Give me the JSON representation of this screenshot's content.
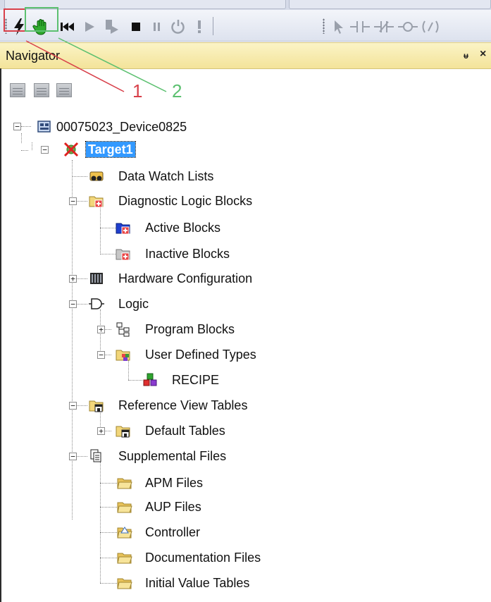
{
  "toolbar": {
    "buttons": [
      {
        "name": "go-online-toggle",
        "icon": "lightning-icon"
      },
      {
        "name": "programmer-mode",
        "icon": "hand-icon"
      },
      {
        "name": "restart",
        "icon": "skip-back-icon"
      },
      {
        "name": "run",
        "icon": "play-icon"
      },
      {
        "name": "run-outputs-disabled",
        "icon": "run-disabled-icon"
      },
      {
        "name": "stop",
        "icon": "stop-icon"
      },
      {
        "name": "pause",
        "icon": "pause-icon"
      },
      {
        "name": "reset",
        "icon": "reset-icon"
      },
      {
        "name": "fault",
        "icon": "exclamation-icon"
      },
      {
        "name": "select",
        "icon": "pointer-icon"
      },
      {
        "name": "no-contact",
        "icon": "contact-no-icon"
      },
      {
        "name": "nc-contact",
        "icon": "contact-nc-icon"
      },
      {
        "name": "coil",
        "icon": "coil-icon"
      },
      {
        "name": "function",
        "icon": "function-icon"
      }
    ]
  },
  "callouts": {
    "one": "1",
    "two": "2"
  },
  "navigator": {
    "title": "Navigator",
    "pin_glyph": "ᵾ",
    "close_glyph": "×"
  },
  "tree": {
    "device": "00075023_Device0825",
    "target": "Target1",
    "items": {
      "data_watch_lists": "Data Watch Lists",
      "diagnostic_logic_blocks": "Diagnostic Logic Blocks",
      "active_blocks": "Active Blocks",
      "inactive_blocks": "Inactive Blocks",
      "hardware_configuration": "Hardware Configuration",
      "logic": "Logic",
      "program_blocks": "Program Blocks",
      "user_defined_types": "User Defined Types",
      "recipe": "RECIPE",
      "reference_view_tables": "Reference View Tables",
      "default_tables": "Default Tables",
      "supplemental_files": "Supplemental Files",
      "apm_files": "APM Files",
      "aup_files": "AUP Files",
      "controller": "Controller",
      "documentation_files": "Documentation Files",
      "initial_value_tables": "Initial Value Tables"
    }
  },
  "colors": {
    "selection": "#3399ff",
    "nav_header": "#f3e39a",
    "callout_red": "#d8404a",
    "callout_green": "#5cc070"
  }
}
